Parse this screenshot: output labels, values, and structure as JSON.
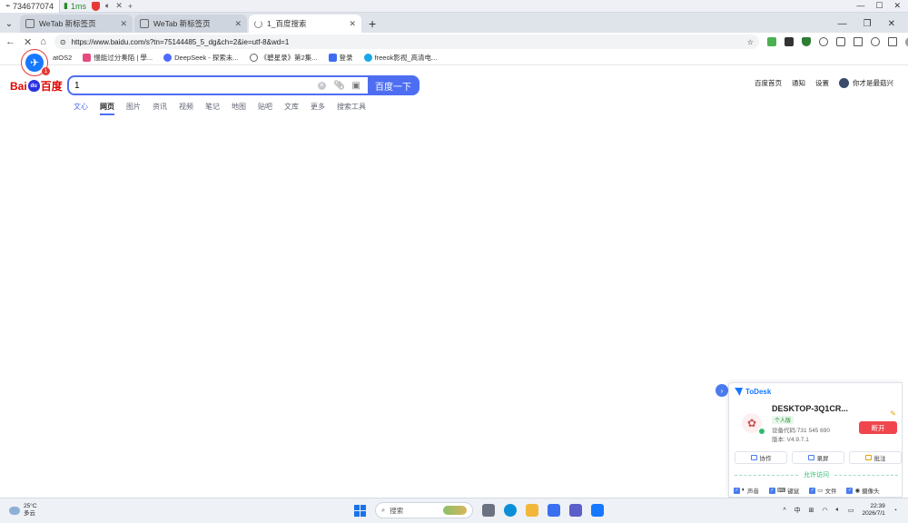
{
  "remote_bar": {
    "session_id": "734677074",
    "latency": "1ms"
  },
  "tabs": [
    {
      "label": "WeTab 新标签页",
      "active": false
    },
    {
      "label": "WeTab 新标签页",
      "active": false
    },
    {
      "label": "1_百度搜索",
      "active": true
    }
  ],
  "address_bar": {
    "url": "https://www.baidu.com/s?tn=75144485_5_dg&ch=2&ie=utf-8&wd=1"
  },
  "bookmarks": [
    {
      "label": "atOS2",
      "color": "#555555"
    },
    {
      "label": "慢能过分奏陌 | 學...",
      "color": "#e84a7f"
    },
    {
      "label": "DeepSeek - 探索未...",
      "color": "#4d6bfe"
    },
    {
      "label": "《碧星录》第2集...",
      "color": "#666666"
    },
    {
      "label": "登录",
      "color": "#3c6df0"
    },
    {
      "label": "freeok影视_高清电...",
      "color": "#19a7e8"
    }
  ],
  "baidu": {
    "logo_left": "Bai",
    "logo_paw": "du",
    "logo_right": "百度",
    "query": "1",
    "search_button": "百度一下",
    "top_links": [
      "百度首页",
      "通知",
      "设置"
    ],
    "user_name": "你才是最菇兴",
    "search_tabs": [
      "文心",
      "网页",
      "图片",
      "资讯",
      "视频",
      "笔记",
      "地图",
      "贴吧",
      "文库",
      "更多",
      "搜索工具"
    ]
  },
  "todesk": {
    "brand": "ToDesk",
    "device_name": "DESKTOP-3Q1CR...",
    "edition_tag": "个人版",
    "device_code": "设备代码:731 545 690",
    "version": "版本: V4.9.7.1",
    "disconnect": "断开",
    "actions": [
      "协作",
      "录屏",
      "批注"
    ],
    "allow_title": "允许访问",
    "permissions": [
      "声音",
      "键鼠",
      "文件",
      "摄像头"
    ]
  },
  "taskbar": {
    "temperature": "25°C",
    "weather": "多云",
    "search_placeholder": "搜索",
    "ime": "中",
    "time": "22:39",
    "date": "2026/7/1"
  }
}
